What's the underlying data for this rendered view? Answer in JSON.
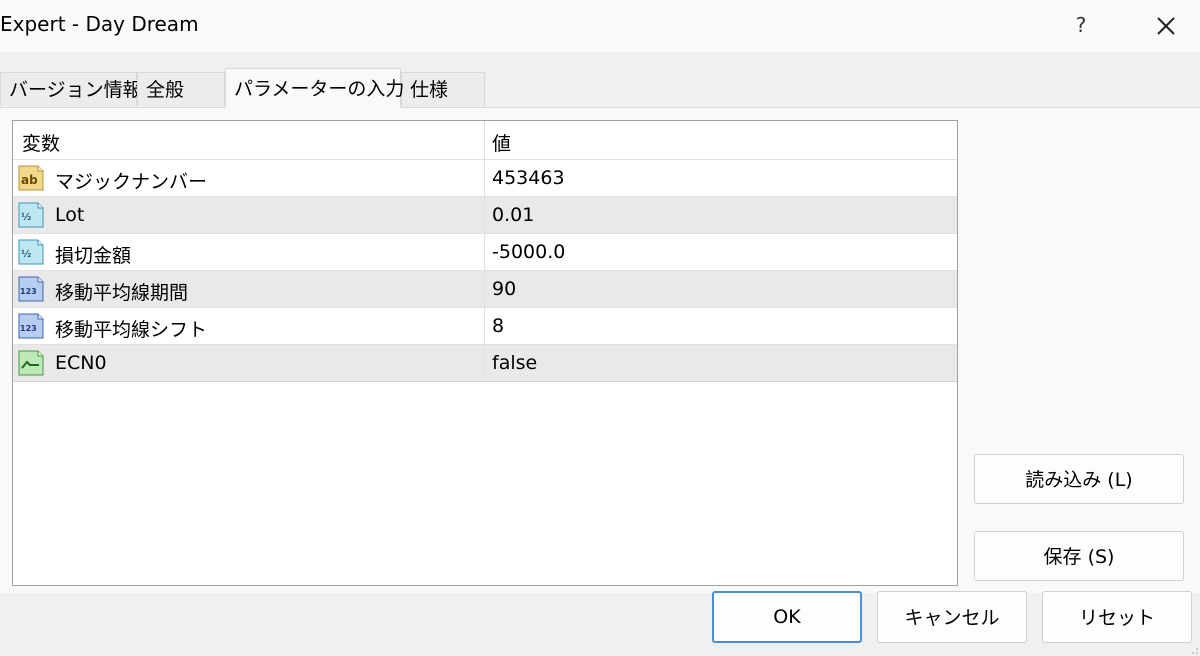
{
  "window": {
    "title": "Expert - Day Dream",
    "help_label": "?"
  },
  "tabs": [
    {
      "label": "バージョン情報"
    },
    {
      "label": "全般"
    },
    {
      "label": "パラメーターの入力"
    },
    {
      "label": "仕様"
    }
  ],
  "active_tab": "パラメーターの入力",
  "table": {
    "headers": {
      "name": "変数",
      "value": "値"
    },
    "rows": [
      {
        "icon": "string-ab-icon",
        "name": "マジックナンバー",
        "value": "453463"
      },
      {
        "icon": "fraction-icon",
        "name": "Lot",
        "value": "0.01"
      },
      {
        "icon": "fraction-icon",
        "name": "損切金額",
        "value": "-5000.0"
      },
      {
        "icon": "integer-123-icon",
        "name": "移動平均線期間",
        "value": "90"
      },
      {
        "icon": "integer-123-icon",
        "name": "移動平均線シフト",
        "value": "8"
      },
      {
        "icon": "boolean-icon",
        "name": "ECN0",
        "value": "false"
      }
    ]
  },
  "side_buttons": {
    "load": "読み込み (L)",
    "save": "保存 (S)"
  },
  "footer_buttons": {
    "ok": "OK",
    "cancel": "キャンセル",
    "reset": "リセット"
  },
  "colors": {
    "accent": "#4a8fd6",
    "row_alt": "#e9e9e9",
    "background": "#f0f0f0"
  }
}
